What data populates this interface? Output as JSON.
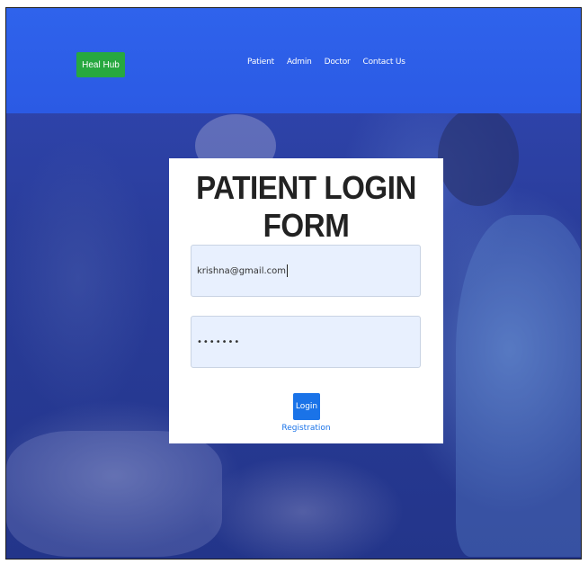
{
  "header": {
    "brand": "Heal Hub",
    "nav": [
      "Patient",
      "Admin",
      "Doctor",
      "Contact Us"
    ]
  },
  "form": {
    "title": "PATIENT LOGIN FORM",
    "email_value": "krishna@gmail.com",
    "password_value": "•••••••",
    "login_label": "Login",
    "registration_label": "Registration"
  },
  "colors": {
    "navbar": "#2f63ec",
    "brand_bg": "#27a83f",
    "button": "#1a73e8",
    "input_bg": "#e8f0fe"
  }
}
